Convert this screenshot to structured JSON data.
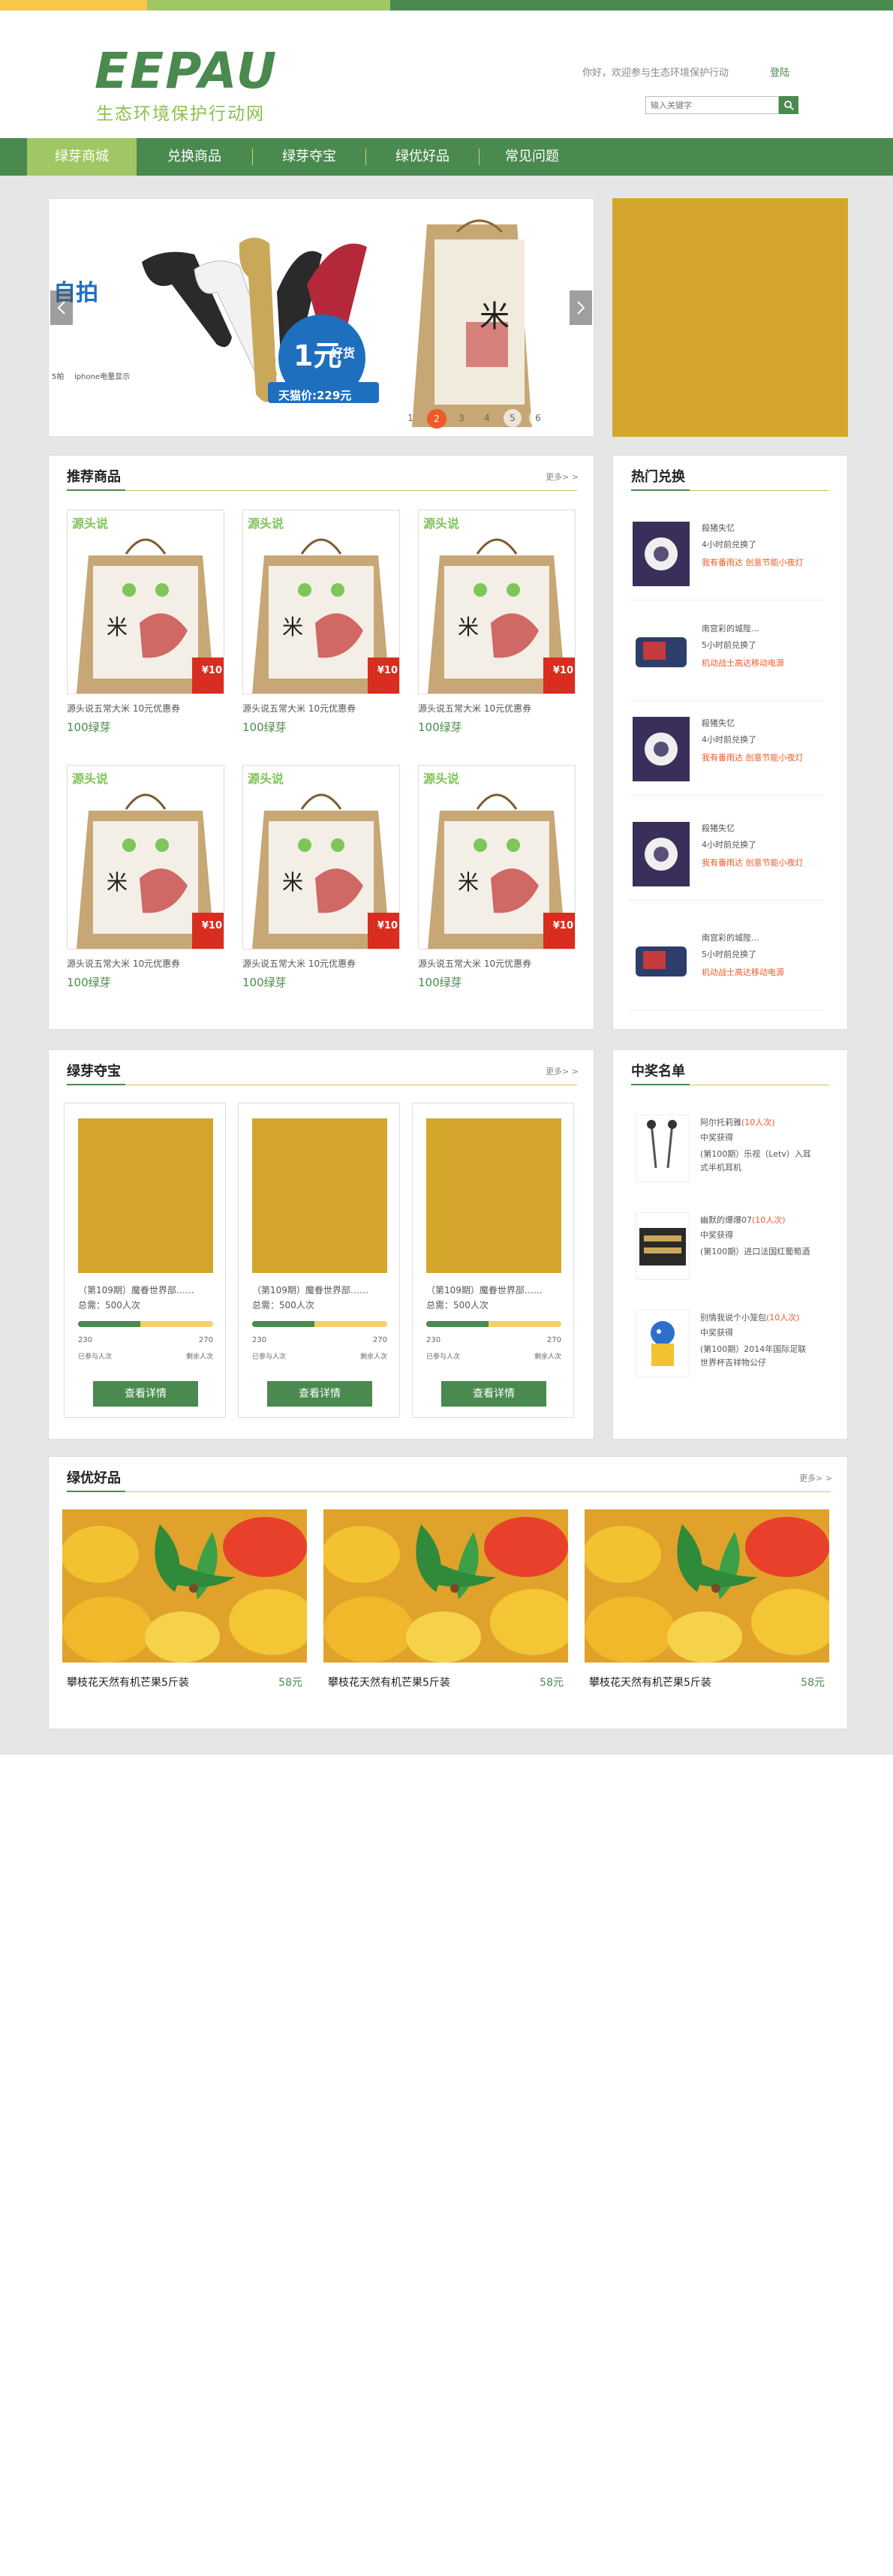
{
  "colors": {
    "green": "#4a8a4f",
    "light_green": "#a1c764",
    "gold": "#d4a72c",
    "orange": "#f05a28",
    "stripe_yellow": "#f6c84a"
  },
  "header": {
    "logo_text": "EEPAU",
    "logo_subtitle": "生态环境保护行动网",
    "welcome": "你好，欢迎参与生态环境保护行动",
    "login": "登陆",
    "search_placeholder": "输入关键字"
  },
  "nav": {
    "items": [
      "绿芽商城",
      "兑换商品",
      "绿芽夺宝",
      "绿优好品",
      "常见问题"
    ],
    "active_index": 0
  },
  "banner": {
    "left_label": "自拍",
    "promo_big": "1元",
    "promo_small": "好货",
    "promo_price": "天猫价:229元",
    "caption_iphone": "iphone电量显示",
    "caption_num": "5帕",
    "pages": [
      "1",
      "2",
      "3",
      "4",
      "5",
      "6"
    ],
    "active_page": "2"
  },
  "recommend": {
    "title": "推荐商品",
    "more": "更多> >",
    "products": [
      {
        "name": "源头说五常大米 10元优惠券",
        "points": "100绿芽",
        "brand": "源头说",
        "badge": "¥10"
      },
      {
        "name": "源头说五常大米 10元优惠券",
        "points": "100绿芽",
        "brand": "源头说",
        "badge": "¥10"
      },
      {
        "name": "源头说五常大米 10元优惠券",
        "points": "100绿芽",
        "brand": "源头说",
        "badge": "¥10"
      },
      {
        "name": "源头说五常大米 10元优惠券",
        "points": "100绿芽",
        "brand": "源头说",
        "badge": "¥10"
      },
      {
        "name": "源头说五常大米 10元优惠券",
        "points": "100绿芽",
        "brand": "源头说",
        "badge": "¥10"
      },
      {
        "name": "源头说五常大米 10元优惠券",
        "points": "100绿芽",
        "brand": "源头说",
        "badge": "¥10"
      }
    ],
    "rice_char": "米"
  },
  "hot": {
    "title": "热门兑换",
    "items": [
      {
        "user": "殺猪失忆",
        "time": "4小时前兑换了",
        "product": "我有番雨达 创意节能小夜灯",
        "thumb": "lamp-icon"
      },
      {
        "user": "南宫彩的城陛...",
        "time": "5小时前兑换了",
        "product": "机动战士高达移动电源",
        "thumb": "powerbank-icon"
      },
      {
        "user": "殺猪失忆",
        "time": "4小时前兑换了",
        "product": "我有番雨达 创意节能小夜灯",
        "thumb": "lamp-icon"
      },
      {
        "user": "殺猪失忆",
        "time": "4小时前兑换了",
        "product": "我有番雨达 创意节能小夜灯",
        "thumb": "lamp-icon"
      },
      {
        "user": "南宫彩的城陛...",
        "time": "5小时前兑换了",
        "product": "机动战士高达移动电源",
        "thumb": "powerbank-icon"
      }
    ]
  },
  "treasure": {
    "title": "绿芽夺宝",
    "more": "更多> >",
    "items": [
      {
        "title": "（第109期）魔眷世界部……",
        "total": "总需：500人次",
        "joined": "230",
        "remain": "270",
        "joined_label": "已参与人次",
        "remain_label": "剩余人次",
        "progress": 0.46,
        "button": "查看详情"
      },
      {
        "title": "（第109期）魔眷世界部……",
        "total": "总需：500人次",
        "joined": "230",
        "remain": "270",
        "joined_label": "已参与人次",
        "remain_label": "剩余人次",
        "progress": 0.46,
        "button": "查看详情"
      },
      {
        "title": "（第109期）魔眷世界部……",
        "total": "总需：500人次",
        "joined": "230",
        "remain": "270",
        "joined_label": "已参与人次",
        "remain_label": "剩余人次",
        "progress": 0.46,
        "button": "查看详情"
      }
    ]
  },
  "winners": {
    "title": "中奖名单",
    "items": [
      {
        "user": "阿尔托莉雅",
        "count": "(10人次)",
        "status": "中奖获得",
        "prize": "(第100期）乐视（Letv）入耳式半机耳机",
        "thumb": "earphone-icon"
      },
      {
        "user": "幽默的爆爆07",
        "count": "(10人次)",
        "status": "中奖获得",
        "prize": "(第100期）进口法国红葡萄酒",
        "thumb": "wine-box-icon"
      },
      {
        "user": "别情我说个小笼包",
        "count": "(10人次)",
        "status": "中奖获得",
        "prize": "(第100期）2014年国际足联世界杯吉祥物公仔",
        "thumb": "mascot-icon"
      }
    ]
  },
  "goods": {
    "title": "绿优好品",
    "more": "更多> >",
    "items": [
      {
        "name": "攀枝花天然有机芒果5斤装",
        "price": "58元"
      },
      {
        "name": "攀枝花天然有机芒果5斤装",
        "price": "58元"
      },
      {
        "name": "攀枝花天然有机芒果5斤装",
        "price": "58元"
      }
    ]
  }
}
